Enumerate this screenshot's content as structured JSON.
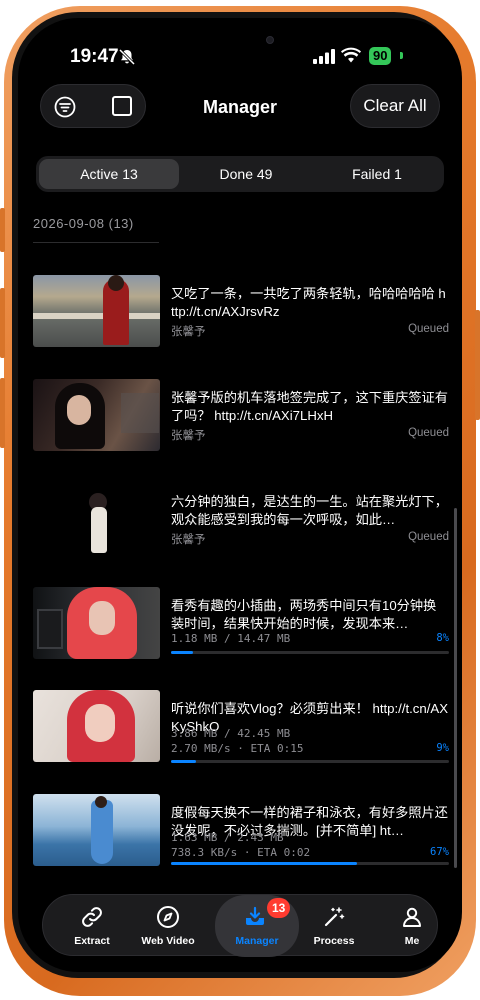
{
  "status_bar": {
    "time": "19:47",
    "battery": "90"
  },
  "header": {
    "title": "Manager",
    "clear_label": "Clear All"
  },
  "segments": [
    {
      "label": "Active 13",
      "active": true
    },
    {
      "label": "Done 49",
      "active": false
    },
    {
      "label": "Failed 1",
      "active": false
    }
  ],
  "date_header": "2026-09-08  (13)",
  "items": [
    {
      "title": "又吃了一条，一共吃了两条轻轨，哈哈哈哈哈 http://t.cn/AXJrsvRz",
      "author": "张馨予",
      "status": "Queued"
    },
    {
      "title": "张馨予版的机车落地签完成了，这下重庆签证有了吗？ http://t.cn/AXi7LHxH",
      "author": "张馨予",
      "status": "Queued"
    },
    {
      "title": "六分钟的独白，是达生的一生。站在聚光灯下，观众能感受到我的每一次呼吸，如此…",
      "author": "张馨予",
      "status": "Queued"
    },
    {
      "title": "看秀有趣的小插曲，两场秀中间只有10分钟换装时间，结果快开始的时候，发现本来…",
      "size": "1.18 MB / 14.47 MB",
      "percent": "8%",
      "progress": 0.08
    },
    {
      "title": "听说你们喜欢Vlog？必须剪出来！ http://t.cn/AXKyShkO",
      "size": "3.86 MB / 42.45 MB",
      "speed": "2.70 MB/s · ETA 0:15",
      "percent": "9%",
      "progress": 0.09
    },
    {
      "title": "度假每天换不一样的裙子和泳衣，有好多照片还没发呢，不必过多揣测。[并不简单] ht…",
      "size": "1.63 MB / 2.43 MB",
      "speed": "738.3 KB/s · ETA 0:02",
      "percent": "67%",
      "progress": 0.67
    }
  ],
  "tabs": [
    {
      "label": "Extract",
      "icon": "link-icon"
    },
    {
      "label": "Web Video",
      "icon": "compass-icon"
    },
    {
      "label": "Manager",
      "icon": "download-tray-icon",
      "badge": "13",
      "active": true
    },
    {
      "label": "Process",
      "icon": "magic-wand-icon"
    },
    {
      "label": "Me",
      "icon": "person-icon"
    }
  ],
  "colors": {
    "accent": "#0a84ff",
    "badge": "#ff3b30",
    "frame": "#e57a2c",
    "battery": "#34c759"
  }
}
